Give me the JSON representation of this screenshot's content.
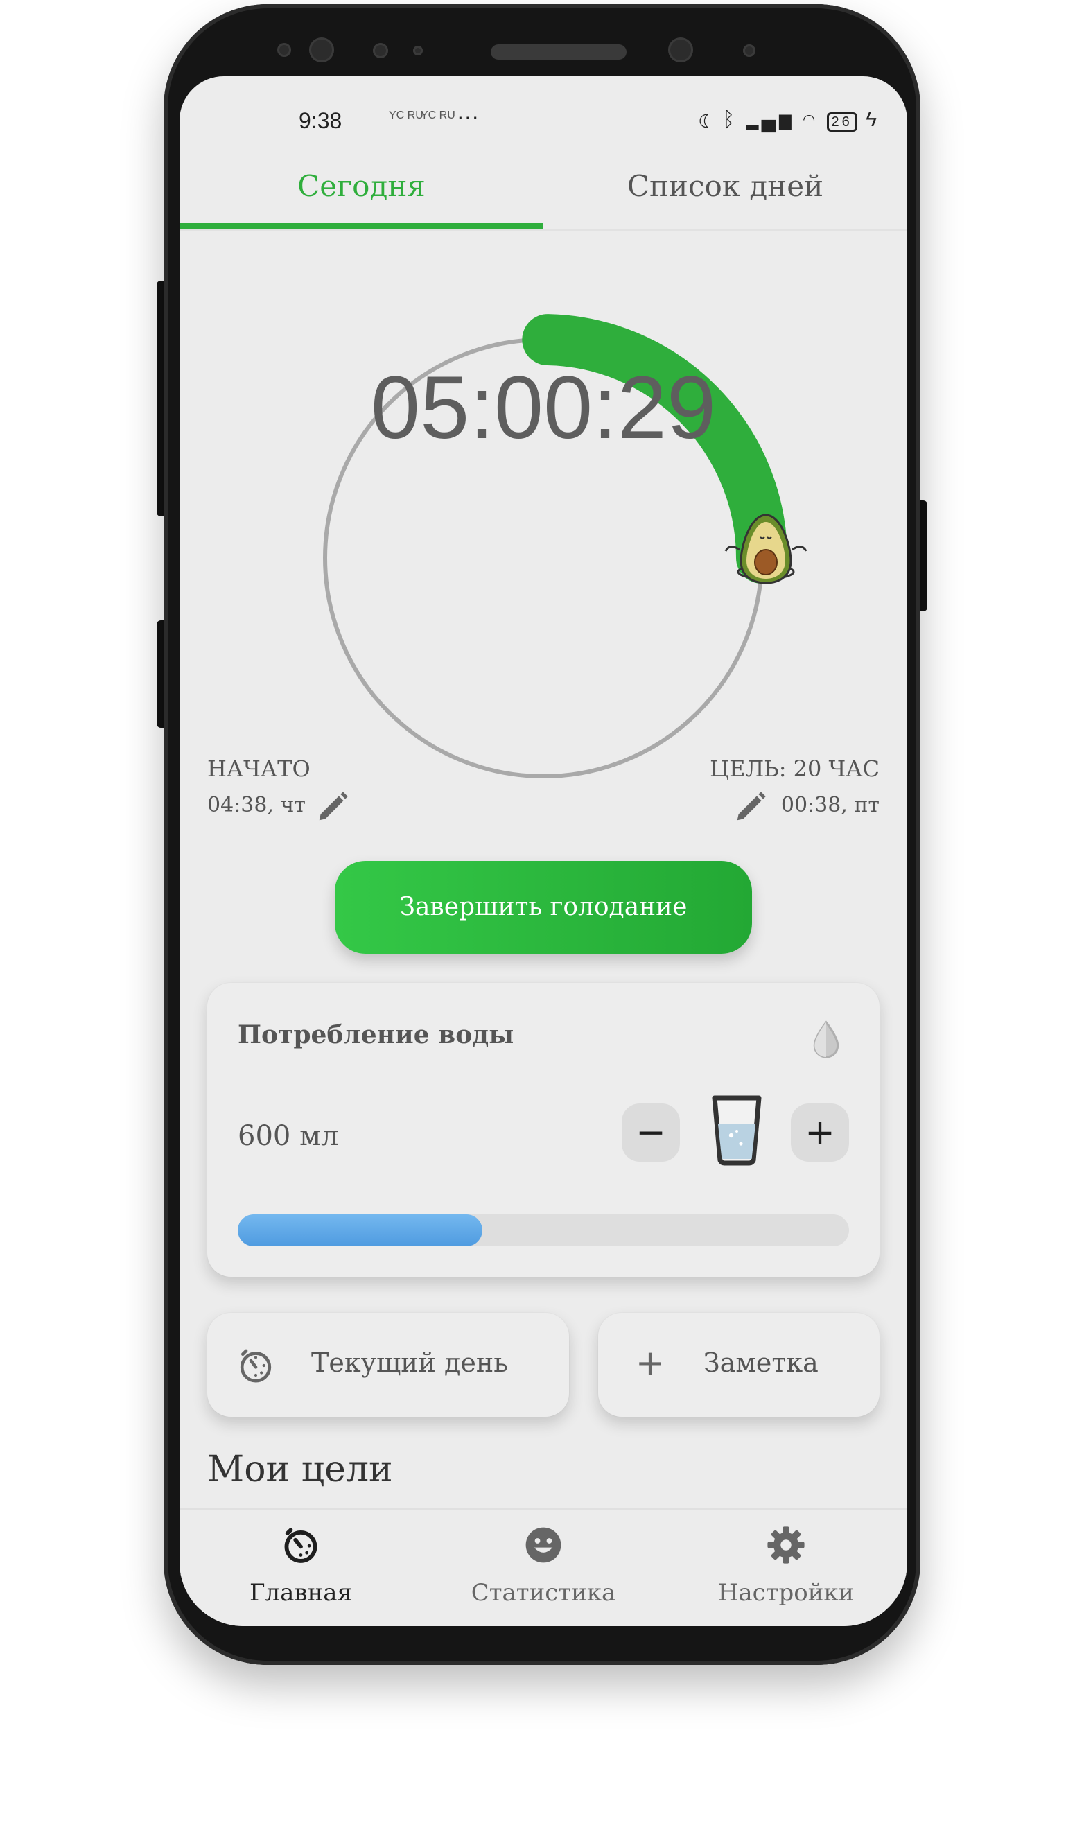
{
  "status_bar": {
    "time": "9:38",
    "carrier_1": "YC RU",
    "carrier_2": "YC RU",
    "more": "···",
    "battery": "26"
  },
  "tabs": [
    {
      "label": "Сегодня",
      "active": true
    },
    {
      "label": "Список дней",
      "active": false
    }
  ],
  "timer": {
    "elapsed": "05:00:29",
    "progress_fraction": 0.25
  },
  "start": {
    "label": "НАЧАТО",
    "value": "04:38, чт"
  },
  "goal": {
    "label": "ЦЕЛЬ: 20 ЧАС",
    "value": "00:38, пт"
  },
  "end_button": {
    "label": "Завершить голодание"
  },
  "water": {
    "title": "Потребление воды",
    "amount": "600 мл",
    "minus_label": "−",
    "plus_label": "+",
    "progress_fraction": 0.4
  },
  "current_day": {
    "label": "Текущий день"
  },
  "note": {
    "icon_label": "+",
    "label": "Заметка"
  },
  "goals": {
    "title": "Мои цели"
  },
  "bottom_nav": [
    {
      "label": "Главная",
      "icon": "timer-icon",
      "active": true
    },
    {
      "label": "Статистика",
      "icon": "smiley-icon",
      "active": false
    },
    {
      "label": "Настройки",
      "icon": "gear-icon",
      "active": false
    }
  ],
  "colors": {
    "accent": "#2fae3c",
    "water": "#5aa6e6",
    "background": "#ececec"
  }
}
